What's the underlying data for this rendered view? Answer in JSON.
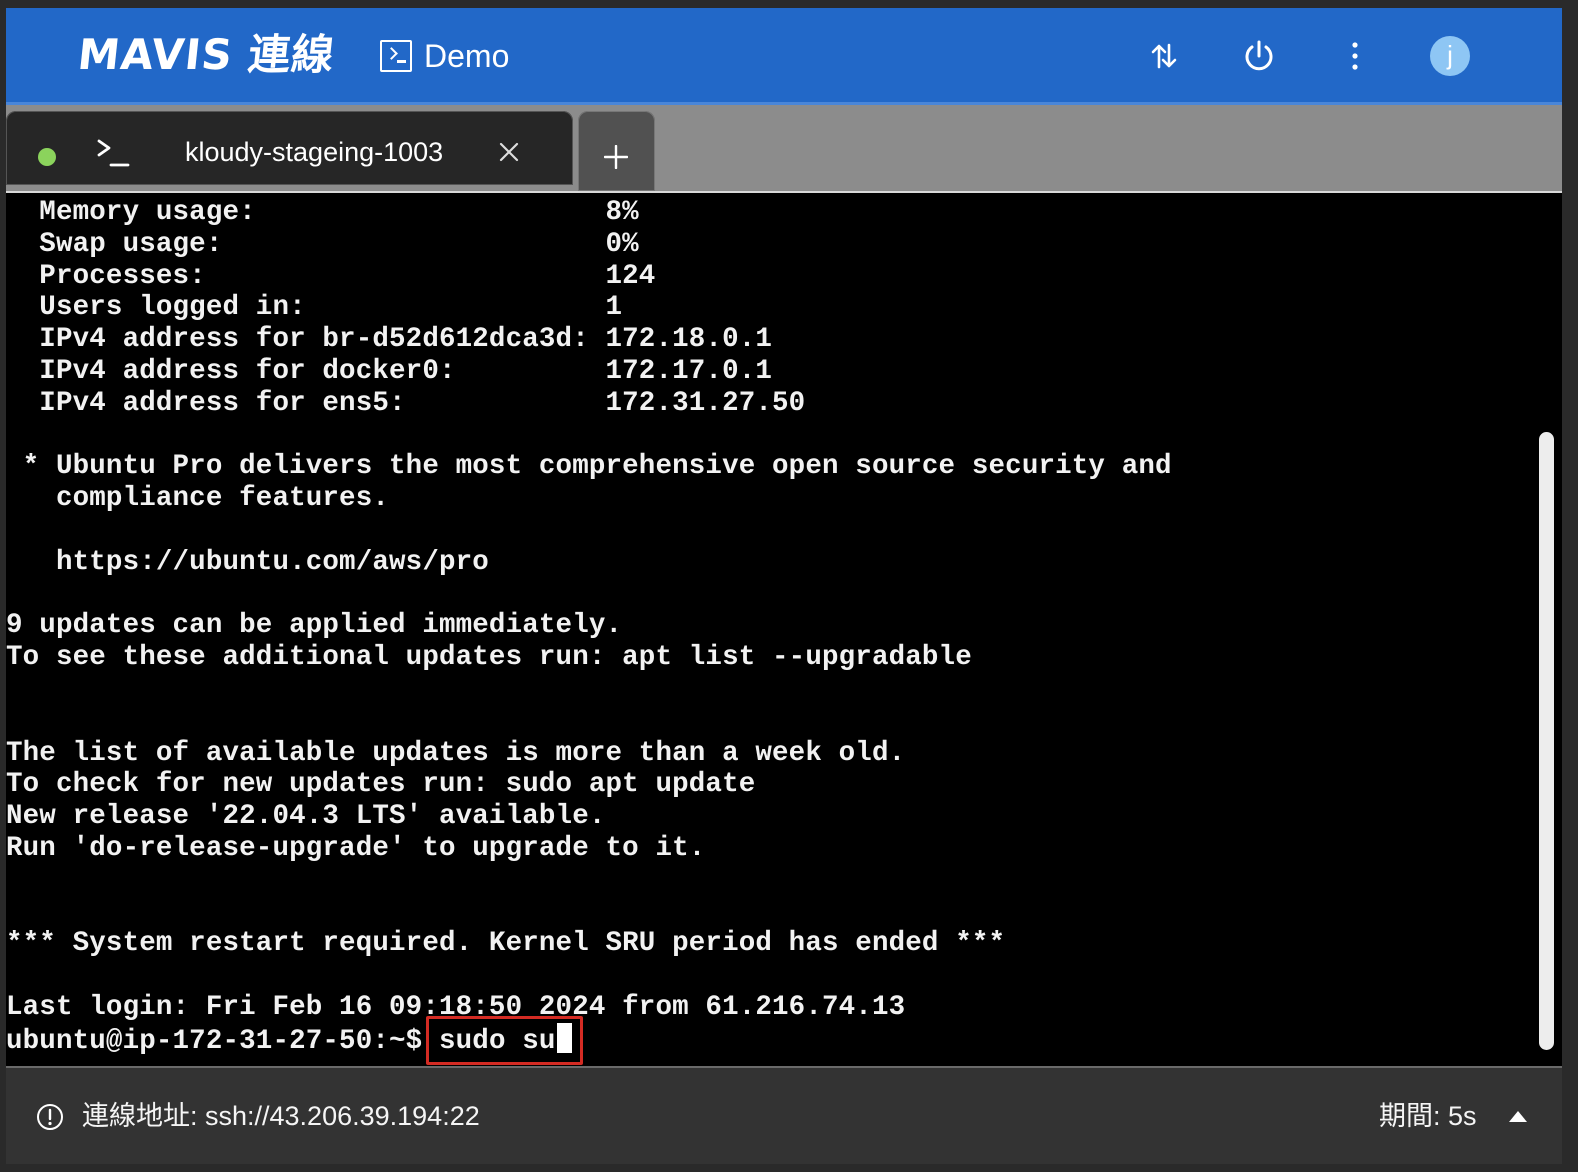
{
  "header": {
    "logo": "MAVIS 連線",
    "workspace_name": "Demo",
    "avatar_initial": "j",
    "icons": [
      "transfer-icon",
      "power-icon",
      "more-vertical-icon"
    ]
  },
  "tabs": [
    {
      "label": "kloudy-stageing-1003",
      "status": "connected",
      "status_color": "#8bd35c"
    }
  ],
  "terminal": {
    "lines": "  Memory usage:                     8%\n  Swap usage:                       0%\n  Processes:                        124\n  Users logged in:                  1\n  IPv4 address for br-d52d612dca3d: 172.18.0.1\n  IPv4 address for docker0:         172.17.0.1\n  IPv4 address for ens5:            172.31.27.50\n\n * Ubuntu Pro delivers the most comprehensive open source security and\n   compliance features.\n\n   https://ubuntu.com/aws/pro\n\n9 updates can be applied immediately.\nTo see these additional updates run: apt list --upgradable\n\n\nThe list of available updates is more than a week old.\nTo check for new updates run: sudo apt update\nNew release '22.04.3 LTS' available.\nRun 'do-release-upgrade' to upgrade to it.\n\n\n*** System restart required. Kernel SRU period has ended ***\n\nLast login: Fri Feb 16 09:18:50 2024 from 61.216.74.13",
    "prompt": "ubuntu@ip-172-31-27-50:~$ ",
    "command": "sudo su",
    "highlight_color": "#d42b23"
  },
  "footer": {
    "connection_address": "連線地址: ssh://43.206.39.194:22",
    "duration": "期間: 5s"
  },
  "colors": {
    "header_bg": "#2268c8",
    "tabbar_bg": "#8c8c8c",
    "terminal_bg": "#000000",
    "footer_bg": "#333333"
  }
}
